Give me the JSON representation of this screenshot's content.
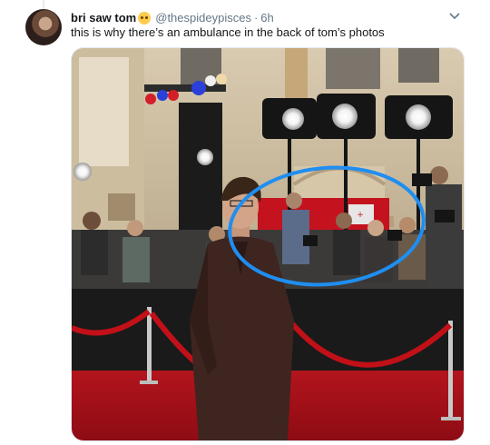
{
  "tweet": {
    "display_name": "bri saw tom",
    "emoji_icon": "smiling-face-with-heart-eyes-emoji",
    "handle": "@thespideypisces",
    "separator": "·",
    "timestamp": "6h",
    "text": "this is why there’s an ambulance in the back of tom’s photos",
    "caret_icon": "chevron-down-icon"
  },
  "photo": {
    "subject": "premiere red carpet photo",
    "annotation_color": "#1f8ef1",
    "carpet_color": "#a8121a",
    "ambulance_color": "#c4131f"
  }
}
